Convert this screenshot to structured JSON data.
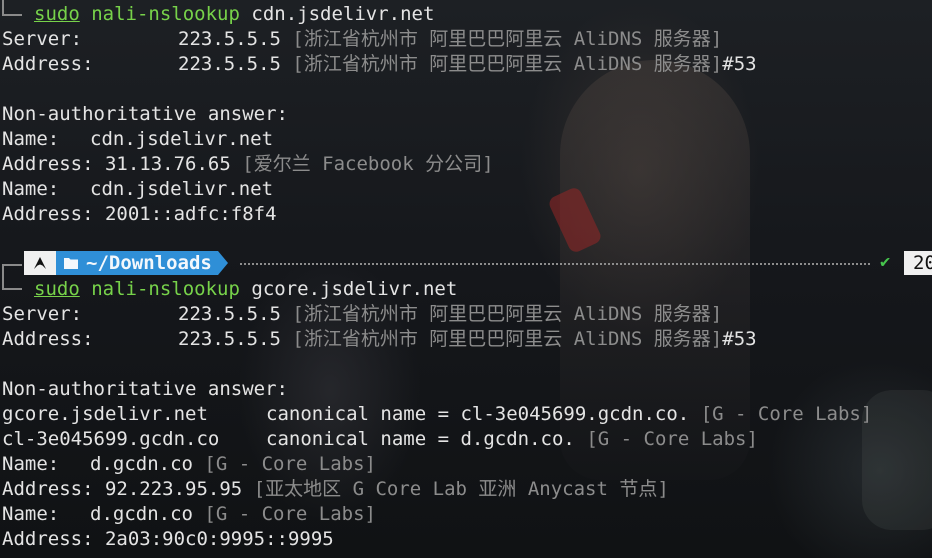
{
  "block1": {
    "sudo": "sudo",
    "program": "nali-nslookup",
    "domain": "cdn.jsdelivr.net",
    "server_label": "Server:",
    "server_ip": "223.5.5.5",
    "server_geo": "[浙江省杭州市 阿里巴巴阿里云 AliDNS 服务器]",
    "address_label": "Address:",
    "address_ip": "223.5.5.5",
    "address_geo": "[浙江省杭州市 阿里巴巴阿里云 AliDNS 服务器]",
    "address_port": "#53",
    "non_auth": "Non-authoritative answer:",
    "records": [
      {
        "label": "Name:",
        "value": "cdn.jsdelivr.net",
        "geo": ""
      },
      {
        "label": "Address:",
        "value": "31.13.76.65",
        "geo": "[爱尔兰 Facebook 分公司]"
      },
      {
        "label": "Name:",
        "value": "cdn.jsdelivr.net",
        "geo": ""
      },
      {
        "label": "Address:",
        "value": "2001::adfc:f8f4",
        "geo": ""
      }
    ]
  },
  "prompt": {
    "os_icon": "arch-linux-icon",
    "folder_icon": "folder-icon",
    "cwd": "~/Downloads",
    "status_icon": "checkmark-icon",
    "status_glyph": "✔",
    "time_fragment": "20"
  },
  "block2": {
    "sudo": "sudo",
    "program": "nali-nslookup",
    "domain": "gcore.jsdelivr.net",
    "server_label": "Server:",
    "server_ip": "223.5.5.5",
    "server_geo": "[浙江省杭州市 阿里巴巴阿里云 AliDNS 服务器]",
    "address_label": "Address:",
    "address_ip": "223.5.5.5",
    "address_geo": "[浙江省杭州市 阿里巴巴阿里云 AliDNS 服务器]",
    "address_port": "#53",
    "non_auth": "Non-authoritative answer:",
    "canonical": [
      {
        "host": "gcore.jsdelivr.net",
        "text": "canonical name = cl-3e045699.gcdn.co.",
        "geo": "[G - Core Labs]"
      },
      {
        "host": "cl-3e045699.gcdn.co",
        "text": "canonical name = d.gcdn.co.",
        "geo": "[G - Core Labs]"
      }
    ],
    "records": [
      {
        "label": "Name:",
        "value": "d.gcdn.co",
        "geo": "[G - Core Labs]"
      },
      {
        "label": "Address:",
        "value": "92.223.95.95",
        "geo": "[亚太地区 G Core Lab 亚洲 Anycast 节点]"
      },
      {
        "label": "Name:",
        "value": "d.gcdn.co",
        "geo": "[G - Core Labs]"
      },
      {
        "label": "Address:",
        "value": "2a03:90c0:9995::9995",
        "geo": ""
      }
    ]
  }
}
